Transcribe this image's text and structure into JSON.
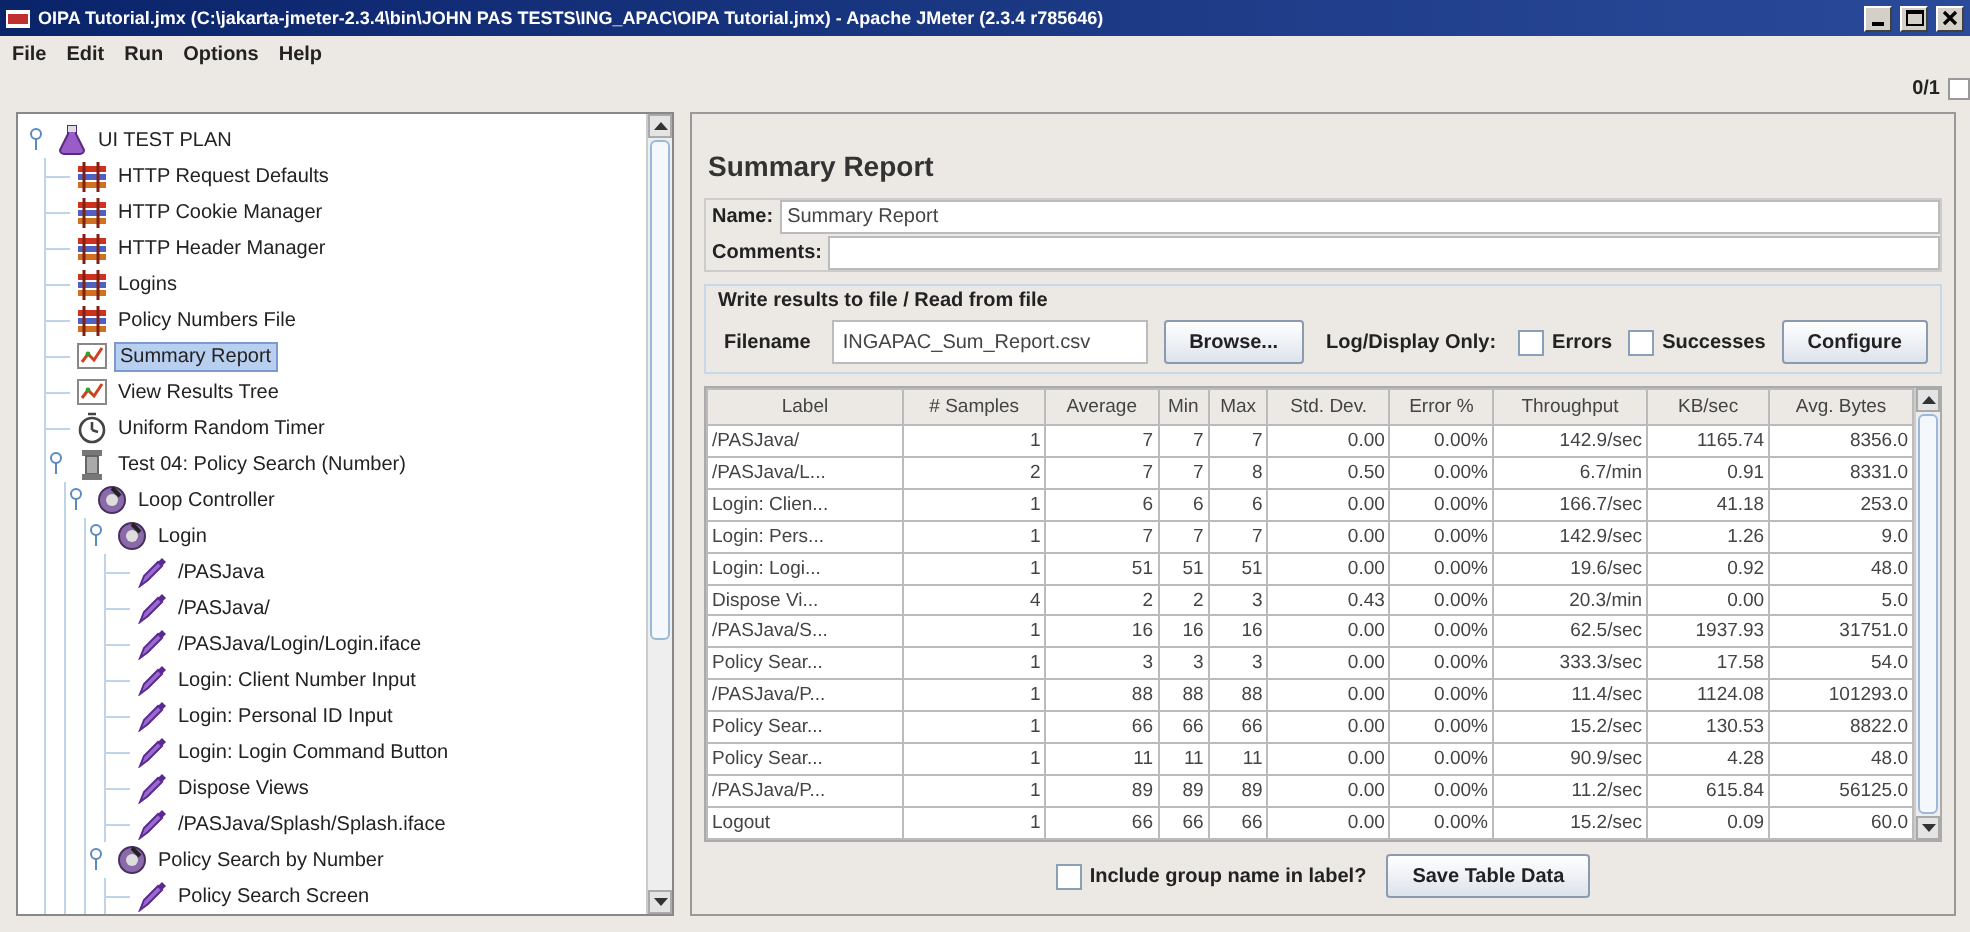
{
  "window": {
    "title": "OIPA Tutorial.jmx (C:\\jakarta-jmeter-2.3.4\\bin\\JOHN PAS TESTS\\ING_APAC\\OIPA Tutorial.jmx) - Apache JMeter (2.3.4 r785646)"
  },
  "menu": [
    "File",
    "Edit",
    "Run",
    "Options",
    "Help"
  ],
  "thread_counter": "0/1",
  "status_checkbox": {
    "checked": false
  },
  "tree": {
    "items": [
      {
        "label": "UI TEST PLAN",
        "kind": "plan",
        "expanded": true,
        "selected": false,
        "children": [
          {
            "label": "HTTP Request Defaults",
            "kind": "config",
            "selected": false
          },
          {
            "label": "HTTP Cookie Manager",
            "kind": "config",
            "selected": false
          },
          {
            "label": "HTTP Header Manager",
            "kind": "config",
            "selected": false
          },
          {
            "label": "Logins",
            "kind": "config",
            "selected": false
          },
          {
            "label": "Policy Numbers File",
            "kind": "config",
            "selected": false
          },
          {
            "label": "Summary Report",
            "kind": "listener",
            "selected": true
          },
          {
            "label": "View Results Tree",
            "kind": "listener",
            "selected": false
          },
          {
            "label": "Uniform Random Timer",
            "kind": "timer",
            "selected": false
          },
          {
            "label": "Test 04: Policy Search (Number)",
            "kind": "thread_group",
            "expanded": true,
            "selected": false,
            "children": [
              {
                "label": "Loop Controller",
                "kind": "controller",
                "expanded": true,
                "selected": false,
                "children": [
                  {
                    "label": "Login",
                    "kind": "controller",
                    "expanded": true,
                    "selected": false,
                    "children": [
                      {
                        "label": "/PASJava",
                        "kind": "sampler",
                        "selected": false
                      },
                      {
                        "label": "/PASJava/",
                        "kind": "sampler",
                        "selected": false
                      },
                      {
                        "label": "/PASJava/Login/Login.iface",
                        "kind": "sampler",
                        "selected": false
                      },
                      {
                        "label": "Login: Client Number Input",
                        "kind": "sampler",
                        "selected": false
                      },
                      {
                        "label": "Login: Personal ID Input",
                        "kind": "sampler",
                        "selected": false
                      },
                      {
                        "label": "Login: Login Command Button",
                        "kind": "sampler",
                        "selected": false
                      },
                      {
                        "label": "Dispose Views",
                        "kind": "sampler",
                        "selected": false
                      },
                      {
                        "label": "/PASJava/Splash/Splash.iface",
                        "kind": "sampler",
                        "selected": false
                      }
                    ]
                  },
                  {
                    "label": "Policy Search by Number",
                    "kind": "controller",
                    "expanded": true,
                    "selected": false,
                    "children": [
                      {
                        "label": "Policy Search Screen",
                        "kind": "sampler",
                        "selected": false
                      }
                    ]
                  }
                ]
              }
            ]
          }
        ]
      }
    ]
  },
  "panel": {
    "title": "Summary Report",
    "name_label": "Name:",
    "name_value": "Summary Report",
    "comments_label": "Comments:",
    "file_group": {
      "title": "Write results to file / Read from file",
      "filename_label": "Filename",
      "filename_value": "INGAPAC_Sum_Report.csv",
      "browse_button": "Browse...",
      "log_label": "Log/Display Only:",
      "checkboxes": [
        {
          "label": "Errors",
          "checked": false
        },
        {
          "label": "Successes",
          "checked": false
        }
      ],
      "configure_button": "Configure"
    },
    "table": {
      "columns": [
        "Label",
        "# Samples",
        "Average",
        "Min",
        "Max",
        "Std. Dev.",
        "Error %",
        "Throughput",
        "KB/sec",
        "Avg. Bytes"
      ],
      "rows": [
        [
          "/PASJava/",
          "1",
          "7",
          "7",
          "7",
          "0.00",
          "0.00%",
          "142.9/sec",
          "1165.74",
          "8356.0"
        ],
        [
          "/PASJava/L...",
          "2",
          "7",
          "7",
          "8",
          "0.50",
          "0.00%",
          "6.7/min",
          "0.91",
          "8331.0"
        ],
        [
          "Login: Clien...",
          "1",
          "6",
          "6",
          "6",
          "0.00",
          "0.00%",
          "166.7/sec",
          "41.18",
          "253.0"
        ],
        [
          "Login: Pers...",
          "1",
          "7",
          "7",
          "7",
          "0.00",
          "0.00%",
          "142.9/sec",
          "1.26",
          "9.0"
        ],
        [
          "Login: Logi...",
          "1",
          "51",
          "51",
          "51",
          "0.00",
          "0.00%",
          "19.6/sec",
          "0.92",
          "48.0"
        ],
        [
          "Dispose Vi...",
          "4",
          "2",
          "2",
          "3",
          "0.43",
          "0.00%",
          "20.3/min",
          "0.00",
          "5.0"
        ],
        [
          "/PASJava/S...",
          "1",
          "16",
          "16",
          "16",
          "0.00",
          "0.00%",
          "62.5/sec",
          "1937.93",
          "31751.0"
        ],
        [
          "Policy Sear...",
          "1",
          "3",
          "3",
          "3",
          "0.00",
          "0.00%",
          "333.3/sec",
          "17.58",
          "54.0"
        ],
        [
          "/PASJava/P...",
          "1",
          "88",
          "88",
          "88",
          "0.00",
          "0.00%",
          "11.4/sec",
          "1124.08",
          "101293.0"
        ],
        [
          "Policy Sear...",
          "1",
          "66",
          "66",
          "66",
          "0.00",
          "0.00%",
          "15.2/sec",
          "130.53",
          "8822.0"
        ],
        [
          "Policy Sear...",
          "1",
          "11",
          "11",
          "11",
          "0.00",
          "0.00%",
          "90.9/sec",
          "4.28",
          "48.0"
        ],
        [
          "/PASJava/P...",
          "1",
          "89",
          "89",
          "89",
          "0.00",
          "0.00%",
          "11.2/sec",
          "615.84",
          "56125.0"
        ],
        [
          "Logout",
          "1",
          "66",
          "66",
          "66",
          "0.00",
          "0.00%",
          "15.2/sec",
          "0.09",
          "60.0"
        ]
      ]
    },
    "group_checkbox": {
      "label": "Include group name in label?",
      "checked": false
    },
    "save_button": "Save Table Data"
  }
}
